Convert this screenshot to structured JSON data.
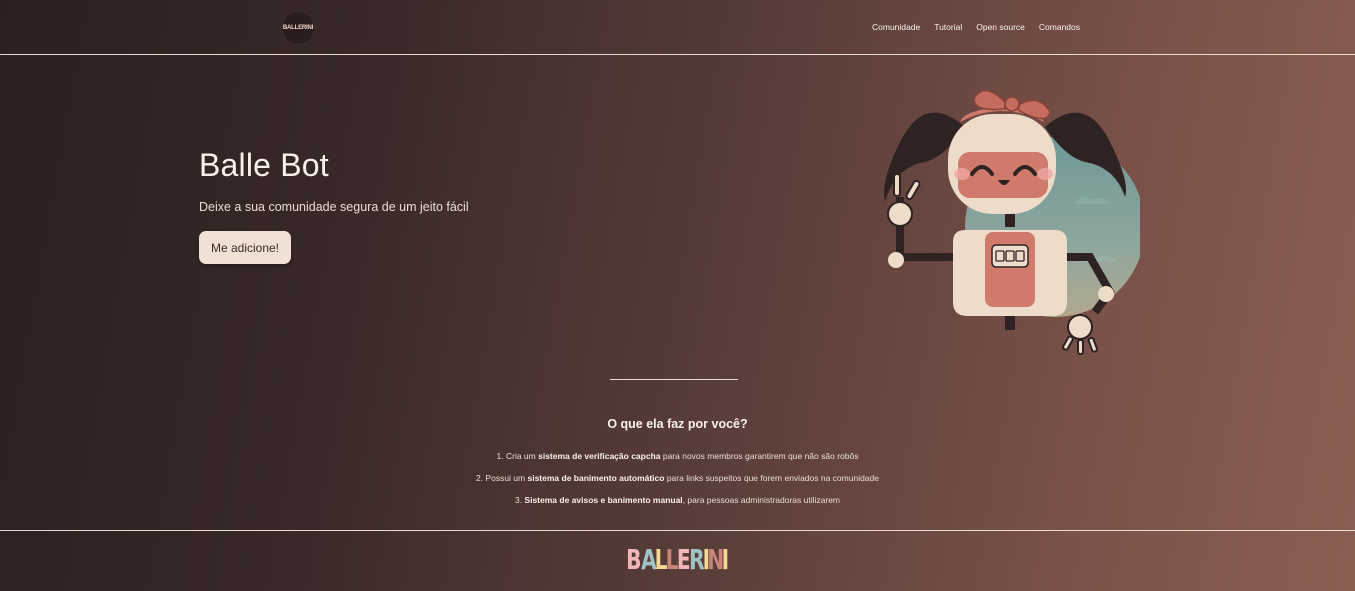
{
  "nav": {
    "logo_text": "BALLERINI",
    "links": [
      "Comunidade",
      "Tutorial",
      "Open source",
      "Comandos"
    ]
  },
  "hero": {
    "title": "Balle Bot",
    "subtitle": "Deixe a sua comunidade segura de um jeito fácil",
    "cta_label": "Me adicione!"
  },
  "features": {
    "title": "O que ela faz por você?",
    "items": [
      {
        "prefix": "1. Cria um ",
        "bold": "sistema de verificação capcha",
        "suffix": " para novos membros garantirem que não são robôs"
      },
      {
        "prefix": "2. Possui um ",
        "bold": "sistema de banimento automático",
        "suffix": " para links suspeitos que forem enviados na comunidade"
      },
      {
        "prefix": "3. ",
        "bold": "Sistema de avisos e banimento manual",
        "suffix": ", para pessoas administradoras utilizarem"
      }
    ]
  },
  "footer": {
    "brand_letters": [
      "B",
      "A",
      "L",
      "L",
      "E",
      "R",
      "I",
      "N",
      "I"
    ],
    "brand_colors": [
      "#f2b6b8",
      "#9fc3c6",
      "#f4d896",
      "#c98579",
      "#f2b6b8",
      "#9fc3c6",
      "#f4d896",
      "#c98579",
      "#f4d896"
    ]
  },
  "colors": {
    "accent": "#f1e0d4",
    "robot_head": "#eedccb",
    "robot_face": "#cf7a6b",
    "robot_hair": "#2e2222",
    "robot_bg": "#7c9e98"
  }
}
